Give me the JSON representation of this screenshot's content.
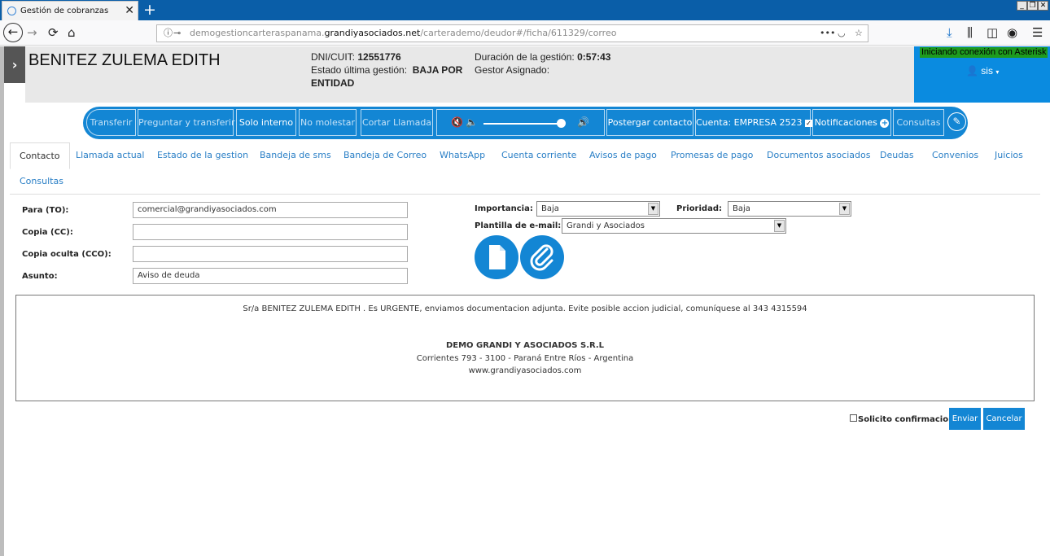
{
  "browser": {
    "tab_title": "Gestión de cobranzas",
    "url_host_pre": "demogestioncarteraspanama.",
    "url_host_main": "grandiyasociados.net",
    "url_path": "/carterademo/deudor#/ficha/611329/correo",
    "url_more": "•••"
  },
  "header": {
    "debtor_name": "BENITEZ ZULEMA EDITH",
    "dni_label": "DNI/CUIT:",
    "dni_value": "12551776",
    "estado_label": "Estado última gestión:",
    "estado_value_1": "BAJA POR",
    "estado_value_2": "ENTIDAD",
    "duracion_label": "Duración de la gestión:",
    "duracion_value": "0:57:43",
    "gestor_label": "Gestor Asignado:",
    "asterisk_msg": "Iniciando conexión con Asterisk",
    "user": "sis"
  },
  "toolbar": {
    "transferir": "Transferir",
    "preguntar": "Preguntar y transferir",
    "solo_interno": "Solo interno",
    "no_molestar": "No molestar",
    "cortar": "Cortar Llamada",
    "postergar": "Postergar contacto",
    "cuenta": "Cuenta: EMPRESA 2523",
    "notificaciones": "Notificaciones",
    "consultas": "Consultas",
    "volume_level": 0.95
  },
  "tabs": [
    "Contacto",
    "Llamada actual",
    "Estado de la gestion",
    "Bandeja de sms",
    "Bandeja de Correo",
    "WhatsApp",
    "Cuenta corriente",
    "Avisos de pago",
    "Promesas de pago",
    "Documentos asociados",
    "Deudas",
    "Convenios",
    "Juicios",
    "Consultas"
  ],
  "form": {
    "para_label": "Para (TO):",
    "para_value": "comercial@grandiyasociados.com",
    "cc_label": "Copia (CC):",
    "cc_value": "",
    "cco_label": "Copia oculta (CCO):",
    "cco_value": "",
    "asunto_label": "Asunto:",
    "asunto_value": "Aviso de deuda",
    "importancia_label": "Importancia:",
    "importancia_value": "Baja",
    "prioridad_label": "Prioridad:",
    "prioridad_value": "Baja",
    "plantilla_label": "Plantilla de e-mail:",
    "plantilla_value": "Grandi y Asociados"
  },
  "body": {
    "line1": "Sr/a BENITEZ ZULEMA EDITH . Es URGENTE, enviamos documentacion adjunta. Evite posible accion judicial, comuníquese al 343 4315594",
    "company": "DEMO GRANDI Y ASOCIADOS S.R.L",
    "address": "Corrientes 793 - 3100 - Paraná Entre Ríos - Argentina",
    "web": "www.grandiyasociados.com"
  },
  "footer": {
    "confirm_label": "Solicito confirmacion",
    "enviar": "Enviar",
    "cancelar": "Cancelar"
  },
  "colors": {
    "accent": "#1386d4",
    "titlebar": "#0a5ea8",
    "asterisk_bg": "#0a8be0",
    "asterisk_msg_bg": "#1e9b1e"
  }
}
